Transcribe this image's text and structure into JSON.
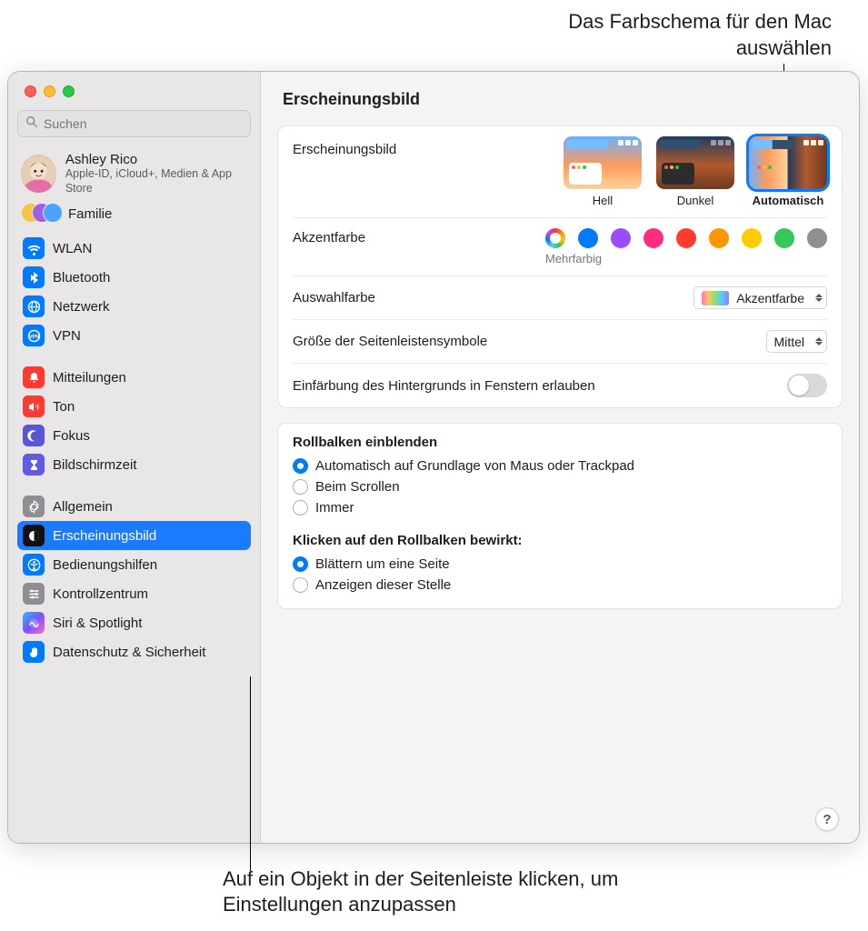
{
  "annotations": {
    "top": "Das Farbschema für den Mac auswählen",
    "bottom": "Auf ein Objekt in der Seitenleiste klicken, um Einstellungen anzupassen"
  },
  "search": {
    "placeholder": "Suchen"
  },
  "account": {
    "name": "Ashley Rico",
    "sub": "Apple-ID, iCloud+, Medien & App Store"
  },
  "family_label": "Familie",
  "sidebar": {
    "items": [
      {
        "label": "WLAN",
        "icon": "wifi",
        "cls": "ic-blue"
      },
      {
        "label": "Bluetooth",
        "icon": "bluetooth",
        "cls": "ic-blue"
      },
      {
        "label": "Netzwerk",
        "icon": "globe",
        "cls": "ic-blue"
      },
      {
        "label": "VPN",
        "icon": "vpn",
        "cls": "ic-blue"
      },
      {
        "gap": true
      },
      {
        "label": "Mitteilungen",
        "icon": "bell",
        "cls": "ic-red"
      },
      {
        "label": "Ton",
        "icon": "speaker",
        "cls": "ic-red"
      },
      {
        "label": "Fokus",
        "icon": "moon",
        "cls": "ic-purple"
      },
      {
        "label": "Bildschirmzeit",
        "icon": "hourglass",
        "cls": "ic-indigo"
      },
      {
        "gap": true
      },
      {
        "label": "Allgemein",
        "icon": "gear",
        "cls": "ic-gray"
      },
      {
        "label": "Erscheinungsbild",
        "icon": "contrast",
        "cls": "ic-black",
        "selected": true
      },
      {
        "label": "Bedienungshilfen",
        "icon": "accessibility",
        "cls": "ic-blue"
      },
      {
        "label": "Kontrollzentrum",
        "icon": "sliders",
        "cls": "ic-gray"
      },
      {
        "label": "Siri & Spotlight",
        "icon": "siri",
        "cls": "ic-siri"
      },
      {
        "label": "Datenschutz & Sicherheit",
        "icon": "hand",
        "cls": "ic-blue"
      }
    ]
  },
  "page": {
    "title": "Erscheinungsbild",
    "appearance_label": "Erscheinungsbild",
    "appearance_options": [
      {
        "label": "Hell",
        "kind": "light"
      },
      {
        "label": "Dunkel",
        "kind": "dark"
      },
      {
        "label": "Automatisch",
        "kind": "auto",
        "selected": true
      }
    ],
    "accent_label": "Akzentfarbe",
    "accent_sublabel": "Mehrfarbig",
    "accent_colors": [
      "multi",
      "blue",
      "purple",
      "pink",
      "red",
      "orange",
      "yellow",
      "green",
      "gray"
    ],
    "highlight_label": "Auswahlfarbe",
    "highlight_value": "Akzentfarbe",
    "sidebar_icon_label": "Größe der Seitenleistensymbole",
    "sidebar_icon_value": "Mittel",
    "tint_label": "Einfärbung des Hintergrunds in Fenstern erlauben",
    "scrollbar": {
      "title": "Rollbalken einblenden",
      "options": [
        {
          "label": "Automatisch auf Grundlage von Maus oder Trackpad",
          "checked": true
        },
        {
          "label": "Beim Scrollen"
        },
        {
          "label": "Immer"
        }
      ]
    },
    "scrollclick": {
      "title": "Klicken auf den Rollbalken bewirkt:",
      "options": [
        {
          "label": "Blättern um eine Seite",
          "checked": true
        },
        {
          "label": "Anzeigen dieser Stelle"
        }
      ]
    }
  },
  "help": "?"
}
